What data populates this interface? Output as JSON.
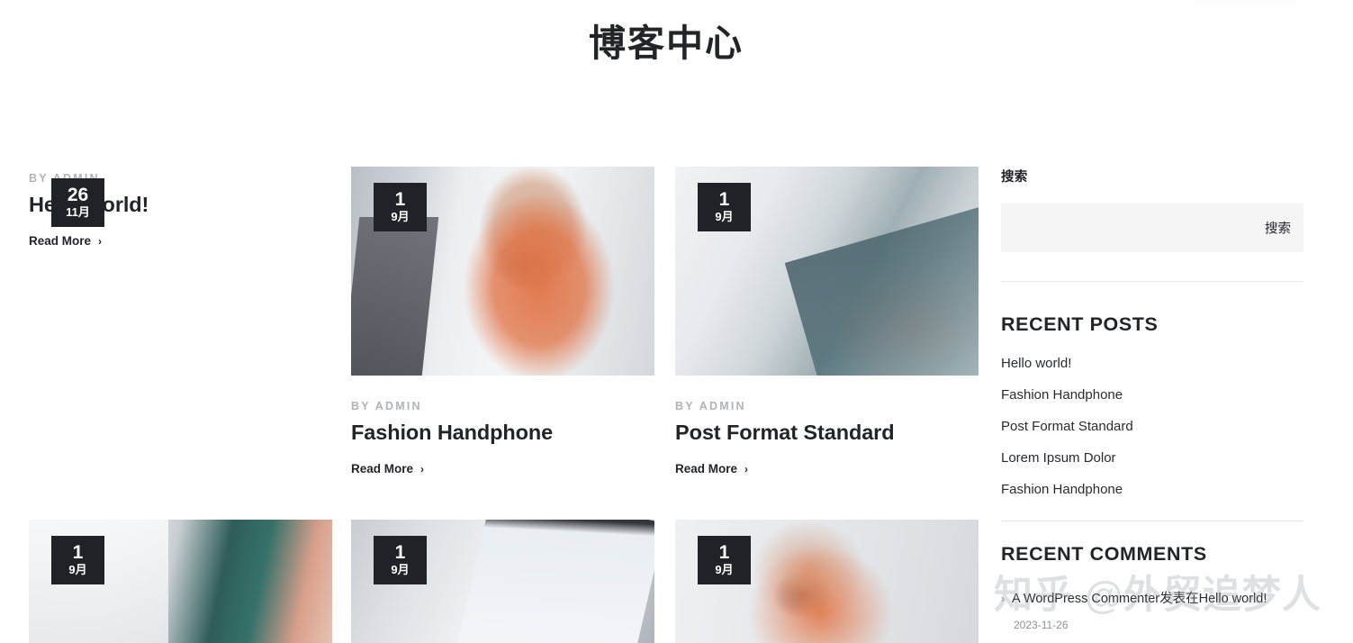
{
  "page": {
    "title": "博客中心",
    "by_prefix": "BY ADMIN",
    "read_more": "Read More",
    "chevron": "›"
  },
  "posts": [
    {
      "day": "26",
      "month": "11月",
      "author": "BY ADMIN",
      "title": "Hello world!",
      "read_more": "Read More",
      "has_image": false,
      "image": ""
    },
    {
      "day": "1",
      "month": "9月",
      "author": "BY ADMIN",
      "title": "Fashion Handphone",
      "read_more": "Read More",
      "has_image": true,
      "image": "bearded-man-pointing-photo"
    },
    {
      "day": "1",
      "month": "9月",
      "author": "BY ADMIN",
      "title": "Post Format Standard",
      "read_more": "Read More",
      "has_image": true,
      "image": "hands-typing-laptop-photo"
    },
    {
      "day": "1",
      "month": "9月",
      "author": "",
      "title": "",
      "read_more": "",
      "has_image": true,
      "image": "desk-workspace-photo"
    },
    {
      "day": "1",
      "month": "9月",
      "author": "",
      "title": "",
      "read_more": "",
      "has_image": true,
      "image": "hand-holding-phone-twitter-photo"
    },
    {
      "day": "1",
      "month": "9月",
      "author": "",
      "title": "",
      "read_more": "",
      "has_image": true,
      "image": "bearded-man-earphones-photo"
    }
  ],
  "sidebar": {
    "search": {
      "label": "搜索",
      "value": "",
      "placeholder": "",
      "button_label": "搜索"
    },
    "recent_posts": {
      "title": "RECENT POSTS",
      "items": [
        "Hello world!",
        "Fashion Handphone",
        "Post Format Standard",
        "Lorem Ipsum Dolor",
        "Fashion Handphone"
      ]
    },
    "recent_comments": {
      "title": "RECENT COMMENTS",
      "bullet": "›",
      "items": [
        {
          "text": "A WordPress Commenter发表在Hello world!",
          "date": "2023-11-26"
        }
      ]
    }
  },
  "watermark": "知乎 @外贸追梦人",
  "colors": {
    "text": "#232427",
    "muted": "#b1b3b7",
    "badge_bg": "#212228",
    "badge_text": "#ffffff",
    "search_bg": "#f5f5f5",
    "divider": "#e6e6e6",
    "background": "#ffffff"
  }
}
